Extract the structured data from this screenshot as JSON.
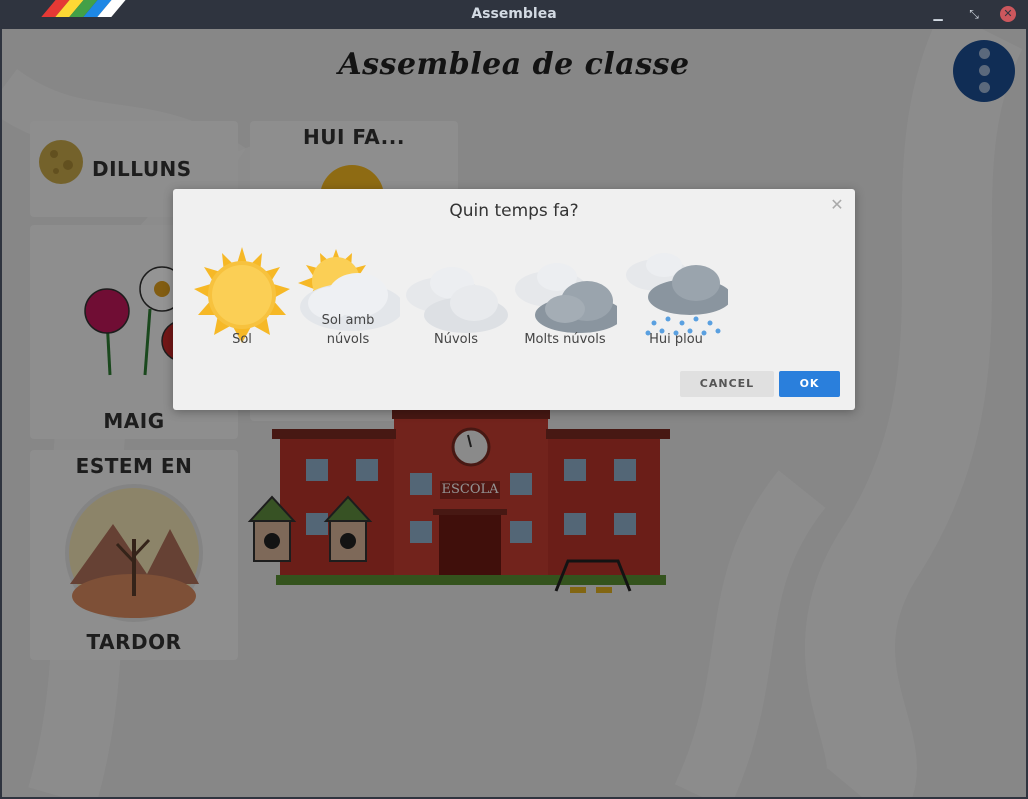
{
  "window": {
    "title": "Assemblea"
  },
  "app": {
    "title": "Assemblea de classe"
  },
  "cards": {
    "day": "DILLUNS",
    "weather_header": "HUI FA...",
    "month": "MAIG",
    "season_header": "ESTEM EN",
    "season": "TARDOR",
    "school_sign": "ESCOLA"
  },
  "dialog": {
    "title": "Quin temps fa?",
    "options": [
      {
        "label": "Sol",
        "icon": "sun-icon"
      },
      {
        "label": "Sol amb núvols",
        "icon": "sun-cloud-icon"
      },
      {
        "label": "Núvols",
        "icon": "clouds-icon"
      },
      {
        "label": "Molts núvols",
        "icon": "dark-clouds-icon"
      },
      {
        "label": "Hui plou",
        "icon": "rain-icon"
      }
    ],
    "cancel_label": "CANCEL",
    "ok_label": "OK"
  },
  "colors": {
    "accent": "#2a7fdc",
    "menu_button": "#1d4e93",
    "school_red": "#b8352a"
  }
}
